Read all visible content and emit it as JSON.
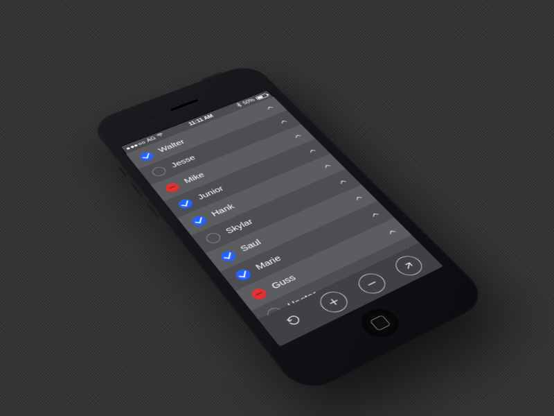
{
  "statusbar": {
    "carrier": "AG",
    "signal_strength": 3,
    "time": "11:11 AM",
    "bluetooth": true,
    "battery_pct": 50,
    "battery_label": "50%"
  },
  "colors": {
    "accent_blue": "#2563ff",
    "accent_red": "#d33"
  },
  "list": {
    "items": [
      {
        "name": "Walter",
        "status": "check"
      },
      {
        "name": "Jesse",
        "status": "empty"
      },
      {
        "name": "Mike",
        "status": "minus"
      },
      {
        "name": "Junior",
        "status": "check"
      },
      {
        "name": "Hank",
        "status": "check"
      },
      {
        "name": "Skylar",
        "status": "empty"
      },
      {
        "name": "Saul",
        "status": "check"
      },
      {
        "name": "Marie",
        "status": "check"
      },
      {
        "name": "Guss",
        "status": "minus"
      },
      {
        "name": "Hector",
        "status": "empty"
      }
    ]
  },
  "toolbar": {
    "buttons": [
      {
        "id": "undo",
        "icon": "undo-icon"
      },
      {
        "id": "add",
        "icon": "plus-icon"
      },
      {
        "id": "remove",
        "icon": "minus-icon"
      },
      {
        "id": "forward",
        "icon": "arrow-up-right-icon"
      }
    ]
  }
}
